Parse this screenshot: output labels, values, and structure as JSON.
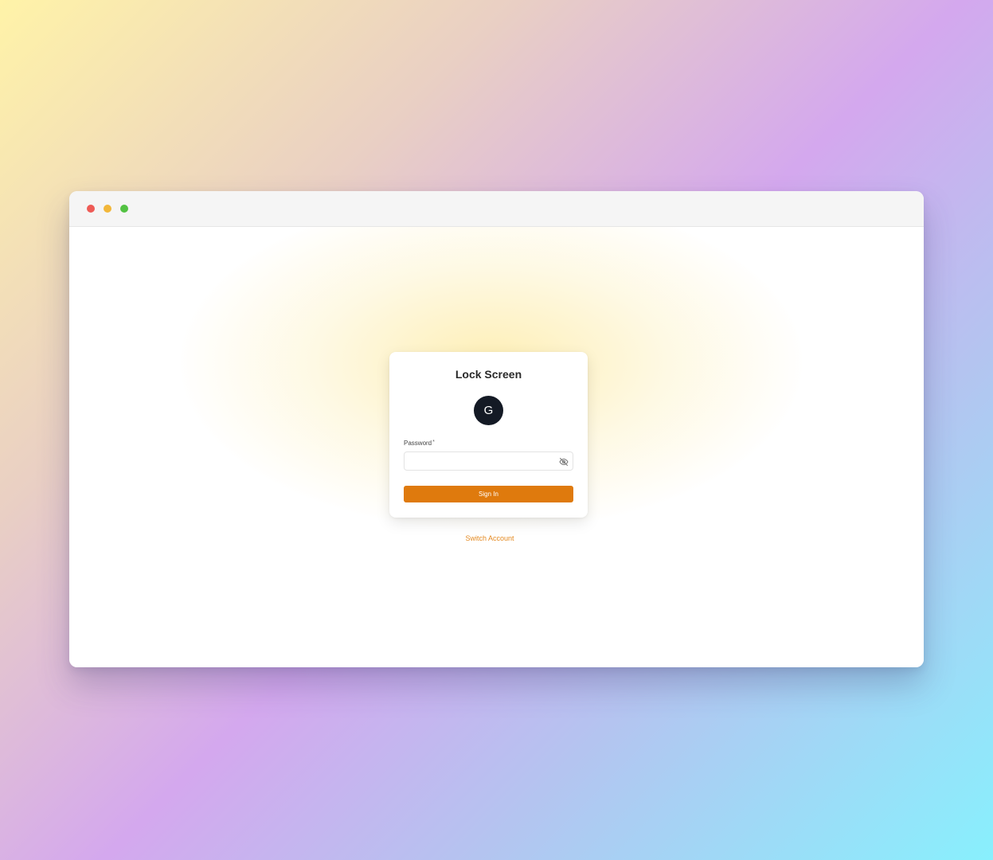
{
  "window": {
    "traffic_lights": {
      "close": "#ee5b56",
      "minimize": "#f2b73a",
      "maximize": "#53c243"
    }
  },
  "lock_screen": {
    "title": "Lock Screen",
    "avatar_initial": "G",
    "password_label": "Password",
    "required_marker": "*",
    "password_value": "",
    "toggle_icon": "eye-off-icon",
    "signin_label": "Sign In",
    "switch_account_label": "Switch Account"
  },
  "colors": {
    "accent": "#df7a0d",
    "avatar_bg": "#141a25",
    "link": "#e48a22"
  }
}
